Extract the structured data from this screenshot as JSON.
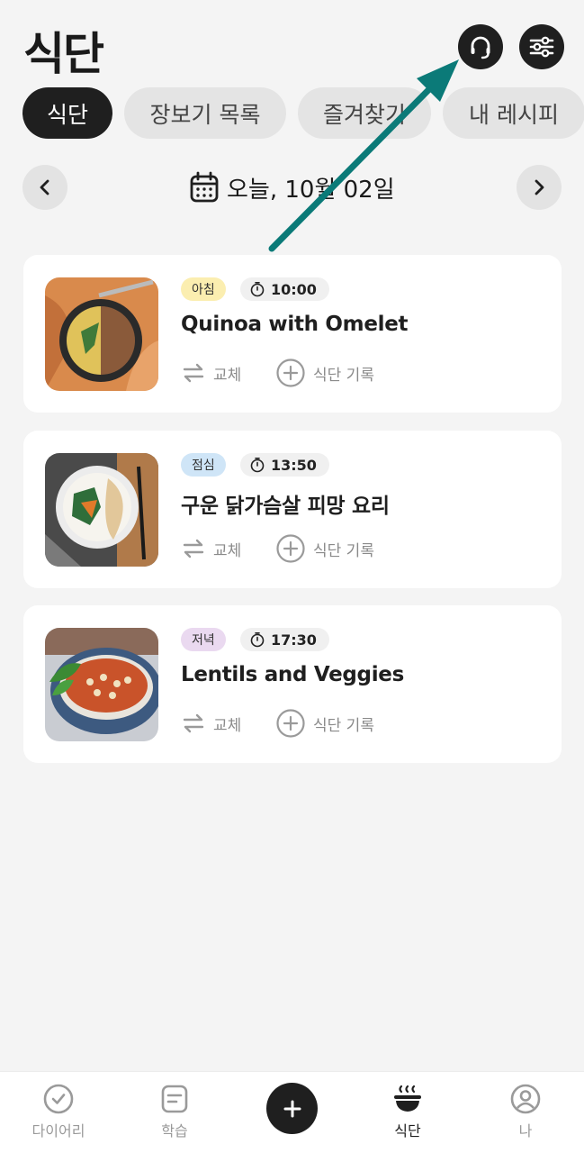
{
  "header": {
    "title": "식단",
    "support_icon": "headset-icon",
    "settings_icon": "sliders-icon"
  },
  "tabs": [
    {
      "label": "식단",
      "active": true
    },
    {
      "label": "장보기 목록",
      "active": false
    },
    {
      "label": "즐겨찾기",
      "active": false
    },
    {
      "label": "내 레시피",
      "active": false
    }
  ],
  "date_nav": {
    "label": "오늘, 10월 02일",
    "prev_icon": "chevron-left-icon",
    "next_icon": "chevron-right-icon",
    "calendar_icon": "calendar-icon"
  },
  "meals": [
    {
      "tag": "아침",
      "tag_color": "#fbeeb0",
      "time": "10:00",
      "title": "Quinoa with Omelet",
      "swap_label": "교체",
      "log_label": "식단 기록"
    },
    {
      "tag": "점심",
      "tag_color": "#cfe5f7",
      "time": "13:50",
      "title": "구운 닭가슴살 피망 요리",
      "swap_label": "교체",
      "log_label": "식단 기록"
    },
    {
      "tag": "저녁",
      "tag_color": "#ead9f0",
      "time": "17:30",
      "title": "Lentils and Veggies",
      "swap_label": "교체",
      "log_label": "식단 기록"
    }
  ],
  "annotation": {
    "arrow_color": "#0b7a78"
  },
  "bottom_nav": [
    {
      "label": "다이어리",
      "icon": "check-circle-icon",
      "active": false
    },
    {
      "label": "학습",
      "icon": "book-icon",
      "active": false
    },
    {
      "label": "",
      "icon": "plus-icon",
      "active": false
    },
    {
      "label": "식단",
      "icon": "bowl-icon",
      "active": true
    },
    {
      "label": "나",
      "icon": "user-icon",
      "active": false
    }
  ]
}
